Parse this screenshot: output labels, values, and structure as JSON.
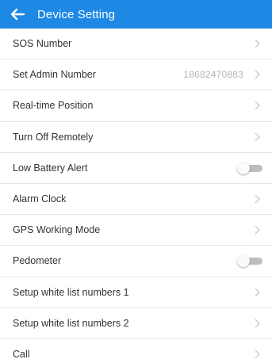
{
  "header": {
    "title": "Device Setting",
    "back_icon": "arrow-left-icon",
    "background_color": "#1e88e5"
  },
  "settings": {
    "items": [
      {
        "label": "SOS Number"
      },
      {
        "label": "Set Admin Number",
        "value": "18682470883"
      },
      {
        "label": "Real-time Position"
      },
      {
        "label": "Turn Off Remotely"
      },
      {
        "label": "Low Battery Alert",
        "toggle": false
      },
      {
        "label": "Alarm Clock"
      },
      {
        "label": "GPS Working Mode"
      },
      {
        "label": "Pedometer",
        "toggle": false
      },
      {
        "label": "Setup white list numbers 1"
      },
      {
        "label": "Setup white list numbers 2"
      },
      {
        "label": "Call"
      }
    ]
  }
}
